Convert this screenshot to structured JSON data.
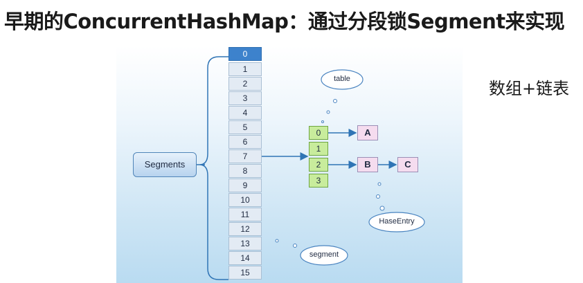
{
  "title": "早期的ConcurrentHashMap：通过分段锁Segment来实现",
  "side_note": "数组+链表",
  "diagram": {
    "segments_label": "Segments",
    "segment_indices": [
      "0",
      "1",
      "2",
      "3",
      "4",
      "5",
      "6",
      "7",
      "8",
      "9",
      "10",
      "11",
      "12",
      "13",
      "14",
      "15"
    ],
    "table_indices": [
      "0",
      "1",
      "2",
      "3"
    ],
    "nodes": {
      "a": "A",
      "b": "B",
      "c": "C"
    },
    "callouts": {
      "table": "table",
      "hash_entry": "HaseEntry",
      "segment": "segment"
    },
    "colors": {
      "segment_selected": "#3d82cc",
      "segment_cell": "#e3ebf4",
      "table_cell": "#c8ec9c",
      "entry_node": "#f5dcef",
      "connector": "#2f74b5"
    }
  }
}
